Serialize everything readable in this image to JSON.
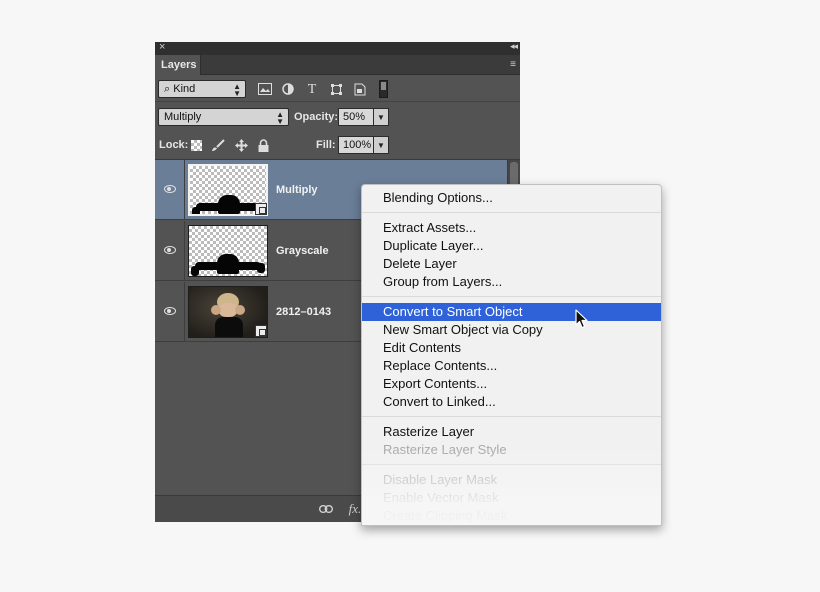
{
  "panel": {
    "close_glyph": "×",
    "collapse_glyph": "◂◂",
    "tab": "Layers",
    "menu_glyph": "≡",
    "filter": {
      "kind": "Kind",
      "kind_glyph": "⌕"
    },
    "blend_mode": "Multiply",
    "opacity_label": "Opacity:",
    "opacity_value": "50%",
    "lock_label": "Lock:",
    "fill_label": "Fill:",
    "fill_value": "100%",
    "layers": [
      {
        "name": "Multiply",
        "selected": true,
        "smart_object": true
      },
      {
        "name": "Grayscale",
        "selected": false,
        "smart_object": false
      },
      {
        "name": "2812–0143",
        "selected": false,
        "smart_object": true
      }
    ],
    "bottom_fx": "fx."
  },
  "menu": {
    "groups": [
      [
        {
          "label": "Blending Options...",
          "enabled": true
        }
      ],
      [
        {
          "label": "Extract Assets...",
          "enabled": true
        },
        {
          "label": "Duplicate Layer...",
          "enabled": true
        },
        {
          "label": "Delete Layer",
          "enabled": true
        },
        {
          "label": "Group from Layers...",
          "enabled": true
        }
      ],
      [
        {
          "label": "Convert to Smart Object",
          "enabled": true,
          "highlighted": true
        },
        {
          "label": "New Smart Object via Copy",
          "enabled": true
        },
        {
          "label": "Edit Contents",
          "enabled": true
        },
        {
          "label": "Replace Contents...",
          "enabled": true
        },
        {
          "label": "Export Contents...",
          "enabled": true
        },
        {
          "label": "Convert to Linked...",
          "enabled": true
        }
      ],
      [
        {
          "label": "Rasterize Layer",
          "enabled": true
        },
        {
          "label": "Rasterize Layer Style",
          "enabled": false
        }
      ],
      [
        {
          "label": "Disable Layer Mask",
          "enabled": false
        },
        {
          "label": "Enable Vector Mask",
          "enabled": false
        },
        {
          "label": "Create Clipping Mask",
          "enabled": false
        }
      ]
    ]
  },
  "colors": {
    "panel_bg": "#535353",
    "selected_layer": "#6a7e98",
    "menu_highlight": "#2f62d8",
    "menu_bg": "#f1f1f1"
  }
}
